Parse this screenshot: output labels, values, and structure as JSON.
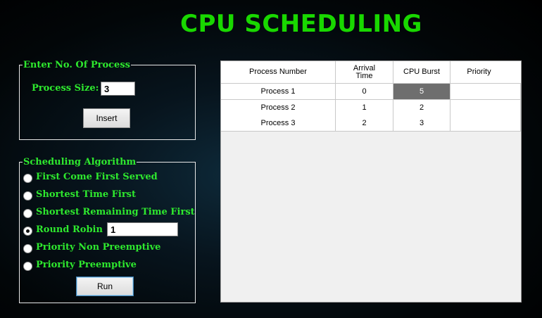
{
  "app": {
    "title": "CPU SCHEDULING"
  },
  "process_group": {
    "legend": "Enter No. Of Process",
    "size_label": "Process Size:",
    "size_value": "3",
    "insert_label": "Insert"
  },
  "algorithm_group": {
    "legend": "Scheduling Algorithm",
    "options": [
      {
        "label": "First Come First Served",
        "checked": false
      },
      {
        "label": "Shortest Time First",
        "checked": false
      },
      {
        "label": "Shortest Remaining Time First",
        "checked": false
      },
      {
        "label": "Round Robin",
        "checked": true
      },
      {
        "label": "Priority Non Preemptive",
        "checked": false
      },
      {
        "label": "Priority Preemptive",
        "checked": false
      }
    ],
    "quantum_value": "1",
    "run_label": "Run"
  },
  "grid": {
    "headers": [
      "Process Number",
      "Arrival\nTime",
      "CPU Burst",
      "Priority"
    ],
    "rows": [
      [
        "Process 1",
        "0",
        "5",
        ""
      ],
      [
        "Process 2",
        "1",
        "2",
        ""
      ],
      [
        "Process 3",
        "2",
        "3",
        ""
      ]
    ]
  },
  "colors": {
    "title": "#19d800",
    "label": "#2ee82e",
    "selected_cell": "#6e6e6e"
  }
}
